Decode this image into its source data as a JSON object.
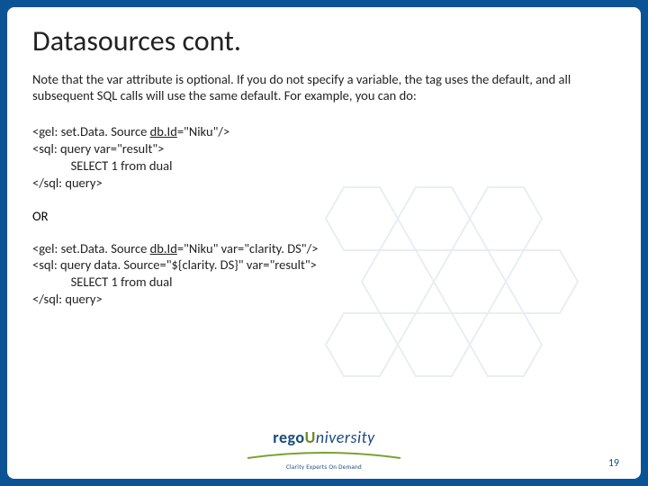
{
  "title": "Datasources cont.",
  "note": "Note that the var attribute is optional. If you do not specify a variable, the tag uses the default, and all subsequent SQL calls will use the same default. For example, you can do:",
  "code1": {
    "l1a": "<gel: set.Data. Source ",
    "l1b": "db.Id",
    "l1c": "=\"Niku\"/>",
    "l2": "<sql: query var=\"result\">",
    "l3": "             SELECT 1 from dual",
    "l4": "</sql: query>"
  },
  "or": "OR",
  "code2": {
    "l1a": "<gel: set.Data. Source ",
    "l1b": "db.Id",
    "l1c": "=\"Niku\" var=\"clarity. DS\"/>",
    "l2": "<sql: query data. Source=\"${clarity. DS}\" var=\"result\">",
    "l3": "             SELECT 1 from dual",
    "l4": "</sql: query>"
  },
  "logo": {
    "part1": "rego",
    "part2": "U",
    "part3": "niversity",
    "tagline": "Clarity Experts On Demand"
  },
  "pagenum": "19"
}
